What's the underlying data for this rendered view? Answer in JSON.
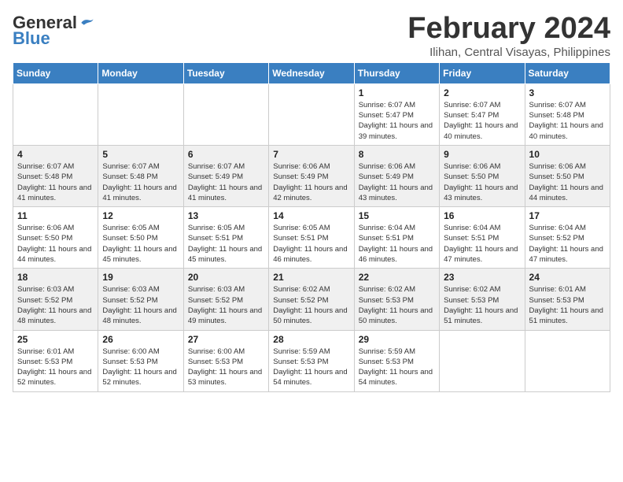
{
  "header": {
    "logo_general": "General",
    "logo_blue": "Blue",
    "month": "February 2024",
    "location": "Ilihan, Central Visayas, Philippines"
  },
  "days_of_week": [
    "Sunday",
    "Monday",
    "Tuesday",
    "Wednesday",
    "Thursday",
    "Friday",
    "Saturday"
  ],
  "weeks": [
    [
      {
        "day": "",
        "info": ""
      },
      {
        "day": "",
        "info": ""
      },
      {
        "day": "",
        "info": ""
      },
      {
        "day": "",
        "info": ""
      },
      {
        "day": "1",
        "info": "Sunrise: 6:07 AM\nSunset: 5:47 PM\nDaylight: 11 hours and 39 minutes."
      },
      {
        "day": "2",
        "info": "Sunrise: 6:07 AM\nSunset: 5:47 PM\nDaylight: 11 hours and 40 minutes."
      },
      {
        "day": "3",
        "info": "Sunrise: 6:07 AM\nSunset: 5:48 PM\nDaylight: 11 hours and 40 minutes."
      }
    ],
    [
      {
        "day": "4",
        "info": "Sunrise: 6:07 AM\nSunset: 5:48 PM\nDaylight: 11 hours and 41 minutes."
      },
      {
        "day": "5",
        "info": "Sunrise: 6:07 AM\nSunset: 5:48 PM\nDaylight: 11 hours and 41 minutes."
      },
      {
        "day": "6",
        "info": "Sunrise: 6:07 AM\nSunset: 5:49 PM\nDaylight: 11 hours and 41 minutes."
      },
      {
        "day": "7",
        "info": "Sunrise: 6:06 AM\nSunset: 5:49 PM\nDaylight: 11 hours and 42 minutes."
      },
      {
        "day": "8",
        "info": "Sunrise: 6:06 AM\nSunset: 5:49 PM\nDaylight: 11 hours and 43 minutes."
      },
      {
        "day": "9",
        "info": "Sunrise: 6:06 AM\nSunset: 5:50 PM\nDaylight: 11 hours and 43 minutes."
      },
      {
        "day": "10",
        "info": "Sunrise: 6:06 AM\nSunset: 5:50 PM\nDaylight: 11 hours and 44 minutes."
      }
    ],
    [
      {
        "day": "11",
        "info": "Sunrise: 6:06 AM\nSunset: 5:50 PM\nDaylight: 11 hours and 44 minutes."
      },
      {
        "day": "12",
        "info": "Sunrise: 6:05 AM\nSunset: 5:50 PM\nDaylight: 11 hours and 45 minutes."
      },
      {
        "day": "13",
        "info": "Sunrise: 6:05 AM\nSunset: 5:51 PM\nDaylight: 11 hours and 45 minutes."
      },
      {
        "day": "14",
        "info": "Sunrise: 6:05 AM\nSunset: 5:51 PM\nDaylight: 11 hours and 46 minutes."
      },
      {
        "day": "15",
        "info": "Sunrise: 6:04 AM\nSunset: 5:51 PM\nDaylight: 11 hours and 46 minutes."
      },
      {
        "day": "16",
        "info": "Sunrise: 6:04 AM\nSunset: 5:51 PM\nDaylight: 11 hours and 47 minutes."
      },
      {
        "day": "17",
        "info": "Sunrise: 6:04 AM\nSunset: 5:52 PM\nDaylight: 11 hours and 47 minutes."
      }
    ],
    [
      {
        "day": "18",
        "info": "Sunrise: 6:03 AM\nSunset: 5:52 PM\nDaylight: 11 hours and 48 minutes."
      },
      {
        "day": "19",
        "info": "Sunrise: 6:03 AM\nSunset: 5:52 PM\nDaylight: 11 hours and 48 minutes."
      },
      {
        "day": "20",
        "info": "Sunrise: 6:03 AM\nSunset: 5:52 PM\nDaylight: 11 hours and 49 minutes."
      },
      {
        "day": "21",
        "info": "Sunrise: 6:02 AM\nSunset: 5:52 PM\nDaylight: 11 hours and 50 minutes."
      },
      {
        "day": "22",
        "info": "Sunrise: 6:02 AM\nSunset: 5:53 PM\nDaylight: 11 hours and 50 minutes."
      },
      {
        "day": "23",
        "info": "Sunrise: 6:02 AM\nSunset: 5:53 PM\nDaylight: 11 hours and 51 minutes."
      },
      {
        "day": "24",
        "info": "Sunrise: 6:01 AM\nSunset: 5:53 PM\nDaylight: 11 hours and 51 minutes."
      }
    ],
    [
      {
        "day": "25",
        "info": "Sunrise: 6:01 AM\nSunset: 5:53 PM\nDaylight: 11 hours and 52 minutes."
      },
      {
        "day": "26",
        "info": "Sunrise: 6:00 AM\nSunset: 5:53 PM\nDaylight: 11 hours and 52 minutes."
      },
      {
        "day": "27",
        "info": "Sunrise: 6:00 AM\nSunset: 5:53 PM\nDaylight: 11 hours and 53 minutes."
      },
      {
        "day": "28",
        "info": "Sunrise: 5:59 AM\nSunset: 5:53 PM\nDaylight: 11 hours and 54 minutes."
      },
      {
        "day": "29",
        "info": "Sunrise: 5:59 AM\nSunset: 5:53 PM\nDaylight: 11 hours and 54 minutes."
      },
      {
        "day": "",
        "info": ""
      },
      {
        "day": "",
        "info": ""
      }
    ]
  ]
}
